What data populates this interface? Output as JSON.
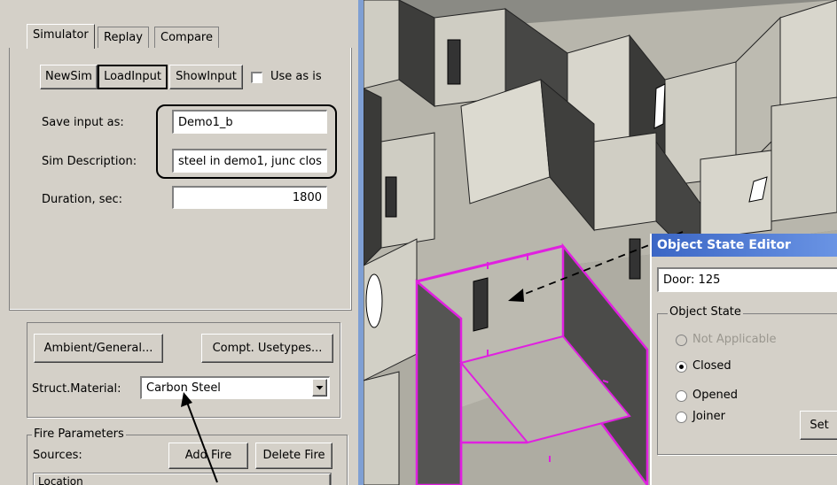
{
  "tabs": [
    {
      "label": "Simulator",
      "active": true
    },
    {
      "label": "Replay",
      "active": false
    },
    {
      "label": "Compare",
      "active": false
    }
  ],
  "toolbar": {
    "newsim": "NewSim",
    "loadinput": "LoadInput",
    "showinput": "ShowInput",
    "use_as_is": "Use as is"
  },
  "form": {
    "save_input_label": "Save input as:",
    "save_input_value": "Demo1_b",
    "sim_desc_label": "Sim Description:",
    "sim_desc_value": "steel in demo1, junc clos",
    "duration_label": "Duration, sec:",
    "duration_value": "1800"
  },
  "general": {
    "ambient_button": "Ambient/General...",
    "compt_button": "Compt. Usetypes...",
    "struct_label": "Struct.Material:",
    "struct_value": "Carbon Steel"
  },
  "fire": {
    "title": "Fire Parameters",
    "sources_label": "Sources:",
    "add_button": "Add Fire",
    "delete_button": "Delete Fire",
    "location_header": "Location"
  },
  "dialog": {
    "title": "Object State Editor",
    "object_id": "Door: 125",
    "group_title": "Object State",
    "options": [
      {
        "label": "Not Applicable",
        "checked": false,
        "disabled": true
      },
      {
        "label": "Closed",
        "checked": true,
        "disabled": false
      },
      {
        "label": "Opened",
        "checked": false,
        "disabled": false
      },
      {
        "label": "Joiner",
        "checked": false,
        "disabled": false
      }
    ],
    "set_button": "Set"
  },
  "colors": {
    "panel": "#d4d0c8",
    "highlight": "#e020e0",
    "title_bar": "#3b66c5",
    "wall_light": "#cfcdc3",
    "wall_dark": "#3a3a38"
  }
}
